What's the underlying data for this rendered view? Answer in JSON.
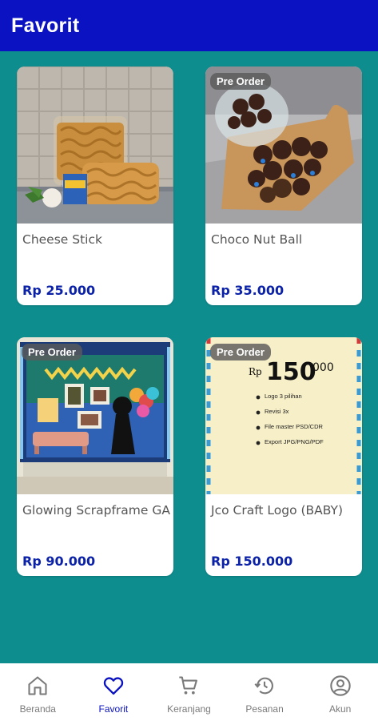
{
  "appbar": {
    "title": "Favorit"
  },
  "products": [
    {
      "name": "Cheese Stick",
      "price": "Rp 25.000",
      "badge": ""
    },
    {
      "name": "Choco Nut Ball",
      "price": "Rp 35.000",
      "badge": "Pre Order"
    },
    {
      "name": "Glowing Scrapframe GA",
      "price": "Rp 90.000",
      "badge": "Pre Order"
    },
    {
      "name": "Jco Craft Logo (BABY)",
      "price": "Rp 150.000",
      "badge": "Pre Order",
      "image_text": {
        "rp": "Rp",
        "amount": "150",
        "cents": "000",
        "lines": [
          "Logo 3 pilihan",
          "Revisi 3x",
          "File master PSD/CDR",
          "Export JPG/PNG/PDF"
        ]
      }
    }
  ],
  "bottom_nav": [
    {
      "label": "Beranda",
      "icon": "home-icon",
      "active": false
    },
    {
      "label": "Favorit",
      "icon": "heart-icon",
      "active": true
    },
    {
      "label": "Keranjang",
      "icon": "cart-icon",
      "active": false
    },
    {
      "label": "Pesanan",
      "icon": "history-icon",
      "active": false
    },
    {
      "label": "Akun",
      "icon": "account-icon",
      "active": false
    }
  ],
  "colors": {
    "appbar": "#0a12c2",
    "background": "#0e8d8f",
    "price": "#0b22a8",
    "nav_active": "#0a12c2",
    "nav_inactive": "#7a7a7a"
  }
}
